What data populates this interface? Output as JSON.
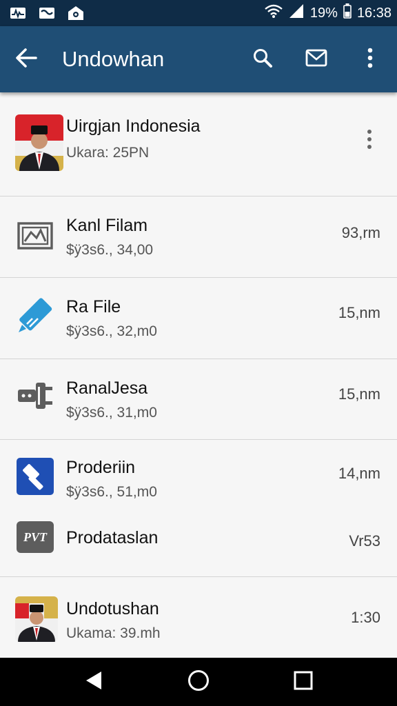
{
  "status_bar": {
    "icons": [
      "pulse-icon",
      "mail-icon",
      "shield-icon"
    ],
    "battery": "19%",
    "time": "16:38"
  },
  "app_bar": {
    "title": "Undowhan",
    "actions": [
      "search-icon",
      "mail-icon",
      "more-icon"
    ]
  },
  "items": [
    {
      "title": "Uirgjan Indonesia",
      "subtitle": "Ukara: 25PN",
      "meta": "",
      "icon": "avatar-portrait"
    },
    {
      "title": "Kanl Filam",
      "subtitle": "$ÿ3s6., 34,00",
      "meta": "93,rm",
      "icon": "image-frame-icon"
    },
    {
      "title": "Ra File",
      "subtitle": "$ÿ3s6., 32,m0",
      "meta": "15,nm",
      "icon": "pen-icon"
    },
    {
      "title": "RanalJesa",
      "subtitle": "$ÿ3s6., 31,m0",
      "meta": "15,nm",
      "icon": "plug-icon"
    },
    {
      "title": "Proderiin",
      "subtitle": "$ÿ3s6., 51,m0",
      "meta": "14,nm",
      "icon": "hammer-icon"
    },
    {
      "title": "Prodataslan",
      "subtitle": "",
      "meta": "Vr53",
      "icon": "pvt-logo-icon",
      "icon_text": "PVT"
    },
    {
      "title": "Undotushan",
      "subtitle": "Ukama: 39.mh",
      "meta": "1:30",
      "icon": "avatar-portrait"
    }
  ],
  "colors": {
    "status_bar": "#0f2c47",
    "app_bar": "#1f4e75",
    "pen_blue": "#2d9ad6",
    "hammer_blue": "#1f4fb4",
    "icon_gray": "#5d5d5d"
  }
}
